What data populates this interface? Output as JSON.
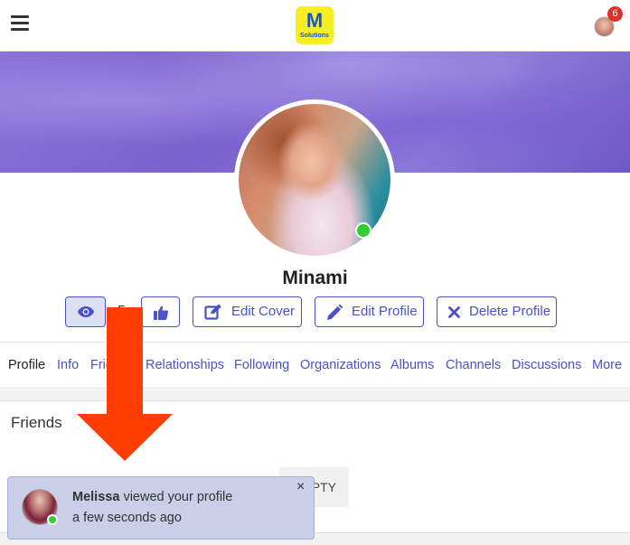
{
  "header": {
    "logo_letter": "M",
    "logo_sub": "Solutions",
    "notification_count": "6",
    "icons": [
      "hamburger-menu-icon",
      "user-avatar"
    ]
  },
  "profile": {
    "name": "Minami",
    "online": true,
    "like_count": "5",
    "buttons": {
      "edit_cover": "Edit Cover",
      "edit_profile": "Edit Profile",
      "delete_profile": "Delete Profile"
    },
    "button_icons": [
      "eye-icon",
      "thumbs-up-icon",
      "edit-square-icon",
      "pencil-icon",
      "times-icon"
    ]
  },
  "tabs": [
    {
      "label": "Profile",
      "active": true
    },
    {
      "label": "Info"
    },
    {
      "label": "Friends"
    },
    {
      "label": "Relationships"
    },
    {
      "label": "Following"
    },
    {
      "label": "Organizations"
    },
    {
      "label": "Albums"
    },
    {
      "label": "Channels"
    },
    {
      "label": "Discussions"
    },
    {
      "label": "More"
    }
  ],
  "friends": {
    "title": "Friends",
    "empty_text": "EMPTY"
  },
  "toast": {
    "user": "Melissa",
    "message": "viewed your profile",
    "time": "a few seconds ago",
    "close": "×"
  },
  "colors": {
    "accent": "#4b52c9",
    "online": "#33cc33",
    "badge": "#e0302a",
    "arrow": "#ff3d00",
    "toast_bg": "#c9cfe9"
  }
}
